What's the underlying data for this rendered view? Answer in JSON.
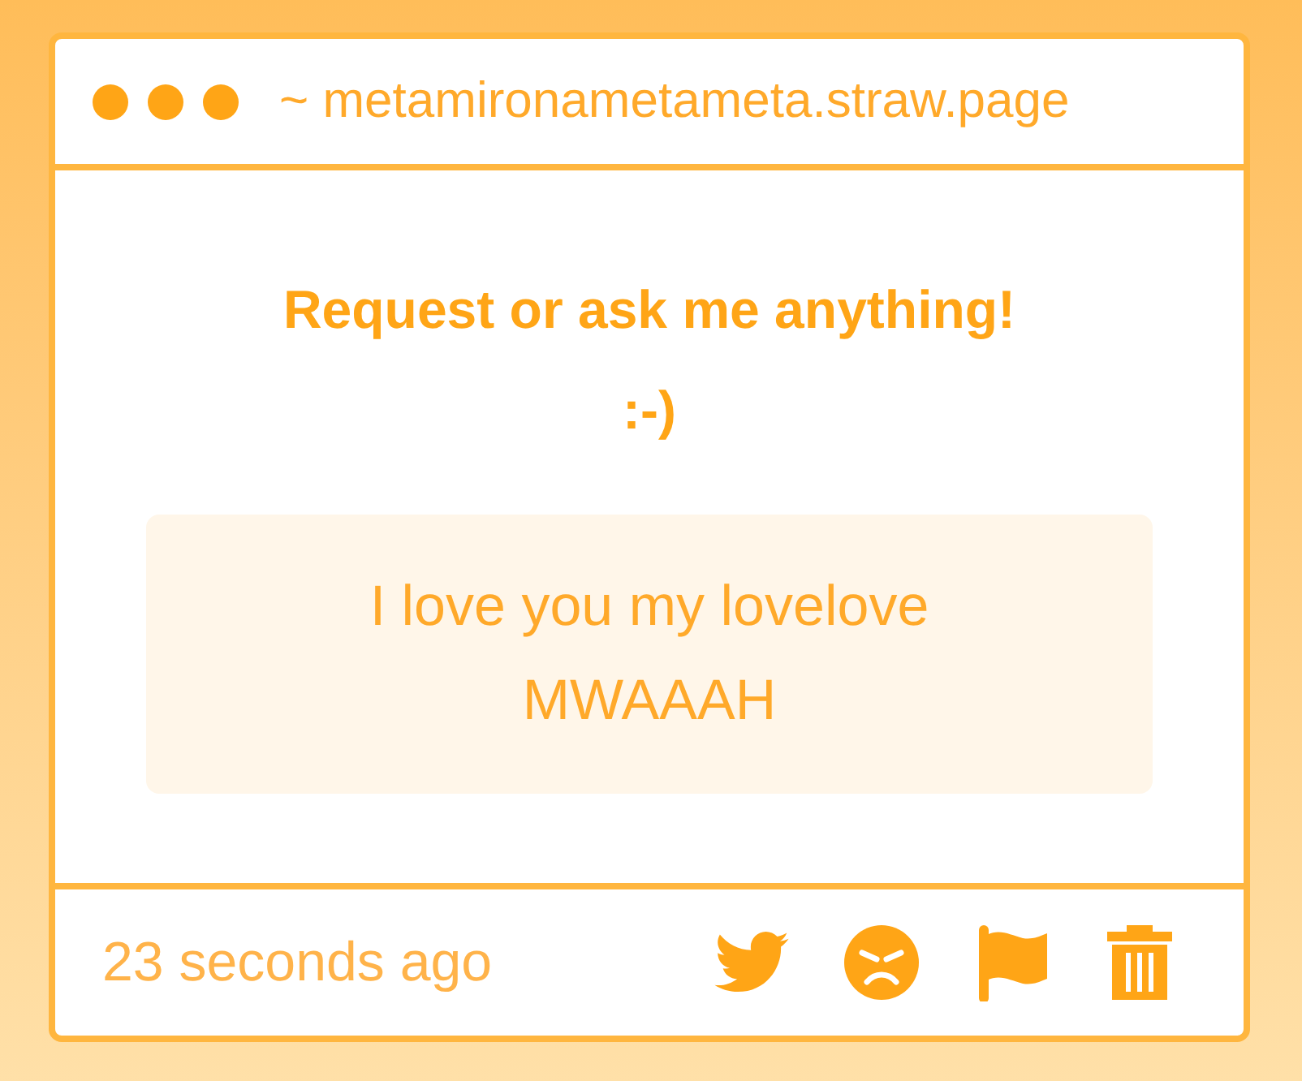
{
  "window": {
    "address": "~ metamironametameta.straw.page"
  },
  "prompt": {
    "heading": "Request or ask me anything!",
    "subheading": ":-)"
  },
  "message": {
    "text": "I love you my lovelove MWAAAH"
  },
  "footer": {
    "time": "23 seconds ago"
  }
}
